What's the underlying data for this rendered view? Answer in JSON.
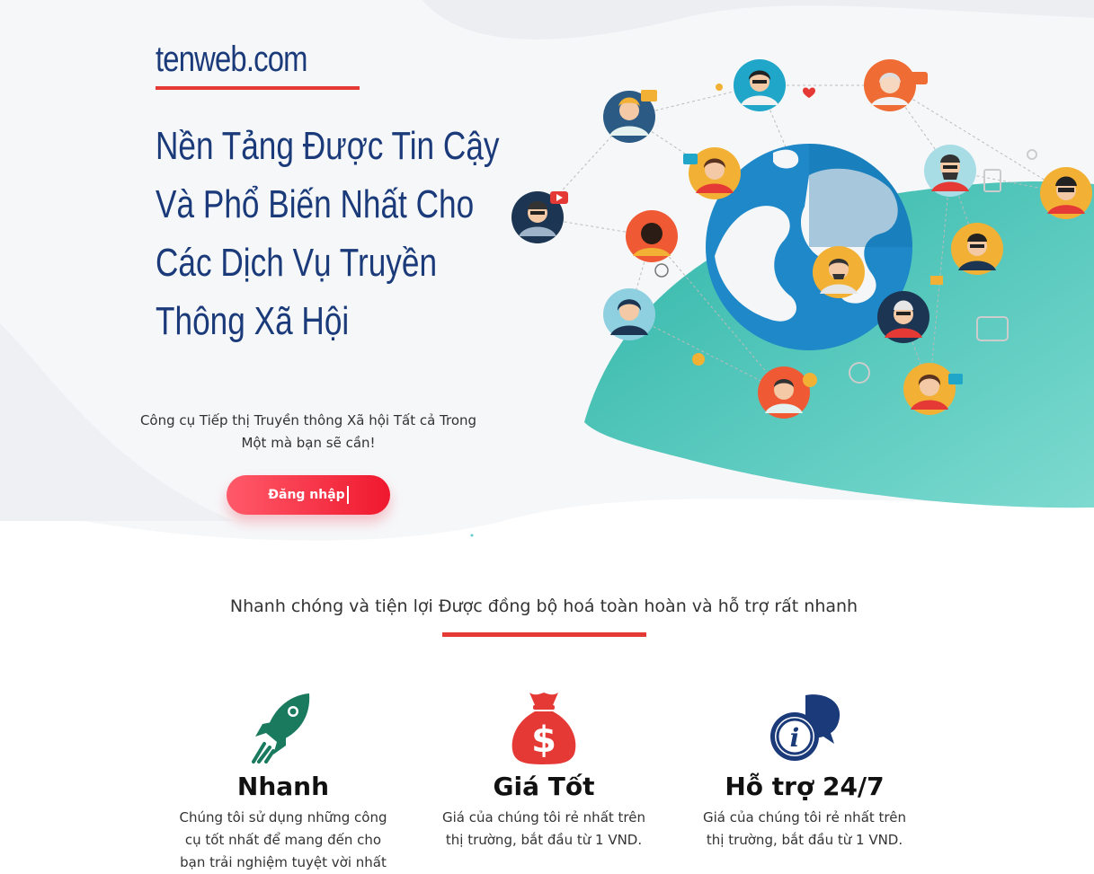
{
  "brand": {
    "name": "tenweb.com"
  },
  "hero": {
    "headline_lines": [
      "Nền Tảng Được Tin Cậy",
      "Và Phổ Biến Nhất Cho",
      "Các Dịch Vụ Truyền",
      "Thông Xã Hội"
    ],
    "subtitle": "Công cụ Tiếp thị Truyền thông Xã hội Tất cả Trong Một mà bạn sẽ cần!",
    "login_label": "Đăng nhập"
  },
  "section": {
    "tagline": "Nhanh chóng và tiện lợi Được đồng bộ hoá toàn hoàn và hỗ trợ rất nhanh"
  },
  "features": [
    {
      "icon": "rocket-icon",
      "title": "Nhanh",
      "desc": "Chúng tôi sử dụng những công cụ tốt nhất để mang đến cho bạn trải nghiệm tuyệt vời nhất"
    },
    {
      "icon": "money-bag-icon",
      "title": "Giá Tốt",
      "desc": "Giá của chúng tôi rẻ nhất trên thị trường, bắt đầu từ 1 VND."
    },
    {
      "icon": "info-chat-icon",
      "title": "Hỗ trợ 24/7",
      "desc": "Giá của chúng tôi rẻ nhất trên thị trường, bắt đầu từ 1 VND."
    }
  ],
  "colors": {
    "brand_blue": "#1a3a7a",
    "accent_red": "#e53935",
    "teal": "#2ab3a6",
    "globe_blue": "#1e88c8"
  }
}
